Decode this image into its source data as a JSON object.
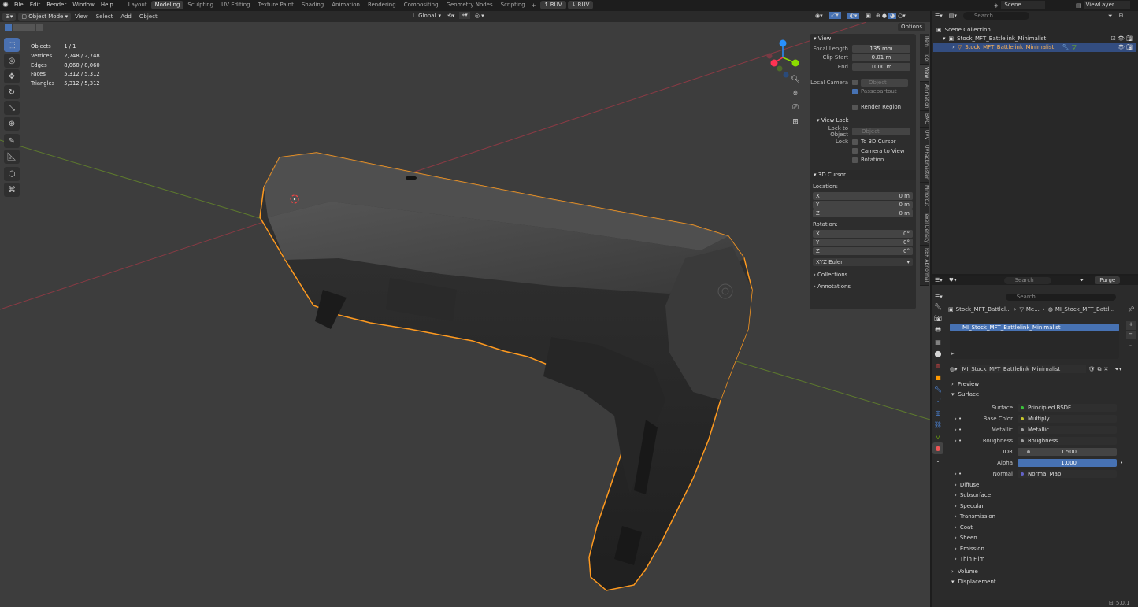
{
  "topbar": {
    "menus": [
      "File",
      "Edit",
      "Render",
      "Window",
      "Help"
    ],
    "workspaces": [
      "Layout",
      "Modeling",
      "Sculpting",
      "UV Editing",
      "Texture Paint",
      "Shading",
      "Animation",
      "Rendering",
      "Compositing",
      "Geometry Nodes",
      "Scripting"
    ],
    "active_workspace": "Modeling",
    "addon_buttons": [
      "RUV",
      "RUV"
    ],
    "scene": "Scene",
    "view_layer": "ViewLayer"
  },
  "viewport_header": {
    "mode": "Object Mode",
    "menus": [
      "View",
      "Select",
      "Add",
      "Object"
    ],
    "transform_orientation": "Global",
    "options_label": "Options"
  },
  "stats": [
    {
      "label": "Objects",
      "value": "1 / 1"
    },
    {
      "label": "Vertices",
      "value": "2,748 / 2,748"
    },
    {
      "label": "Edges",
      "value": "8,060 / 8,060"
    },
    {
      "label": "Faces",
      "value": "5,312 / 5,312"
    },
    {
      "label": "Triangles",
      "value": "5,312 / 5,312"
    }
  ],
  "npanel": {
    "view_title": "View",
    "focal_length_label": "Focal Length",
    "focal_length": "135 mm",
    "clip_start_label": "Clip Start",
    "clip_start": "0.01 m",
    "end_label": "End",
    "end": "1000 m",
    "local_camera_label": "Local Camera",
    "object_placeholder": "Object",
    "passepartout": "Passepartout",
    "render_region": "Render Region",
    "view_lock_title": "View Lock",
    "lock_to_object_label": "Lock to Object",
    "lock_label": "Lock",
    "to_3d_cursor": "To 3D Cursor",
    "camera_to_view": "Camera to View",
    "rotation_check": "Rotation",
    "cursor_title": "3D Cursor",
    "location_label": "Location:",
    "loc": [
      {
        "axis": "X",
        "value": "0 m"
      },
      {
        "axis": "Y",
        "value": "0 m"
      },
      {
        "axis": "Z",
        "value": "0 m"
      }
    ],
    "rotation_label": "Rotation:",
    "rot": [
      {
        "axis": "X",
        "value": "0°"
      },
      {
        "axis": "Y",
        "value": "0°"
      },
      {
        "axis": "Z",
        "value": "0°"
      }
    ],
    "rotation_mode": "XYZ Euler",
    "collections": "Collections",
    "annotations": "Annotations",
    "tabs": [
      "Item",
      "Tool",
      "View",
      "Animation",
      "BMC",
      "UVV",
      "UVPackmaster",
      "Mirrorcut",
      "Texel Density",
      "RBR Abnormal"
    ],
    "active_tab": "View"
  },
  "outliner": {
    "search_placeholder": "Search",
    "scene_collection": "Scene Collection",
    "collection": "Stock_MFT_Battlelink_Minimalist",
    "object": "Stock_MFT_Battlelink_Minimalist"
  },
  "properties": {
    "search_placeholder": "Search",
    "purge": "Purge",
    "breadcrumb": [
      "Stock_MFT_Battlel...",
      "Me...",
      "MI_Stock_MFT_Battl..."
    ],
    "material_slot": "MI_Stock_MFT_Battlelink_Minimalist",
    "material_name": "MI_Stock_MFT_Battlelink_Minimalist",
    "preview": "Preview",
    "surface_section": "Surface",
    "surface_label": "Surface",
    "surface_value": "Principled BSDF",
    "inputs": [
      {
        "label": "Base Color",
        "value": "Multiply",
        "color": "#c7c729"
      },
      {
        "label": "Metallic",
        "value": "Metallic",
        "color": "#a0a0a0"
      },
      {
        "label": "Roughness",
        "value": "Roughness",
        "color": "#a0a0a0"
      }
    ],
    "ior_label": "IOR",
    "ior": "1.500",
    "alpha_label": "Alpha",
    "alpha": "1.000",
    "normal_label": "Normal",
    "normal_value": "Normal Map",
    "subsections": [
      "Diffuse",
      "Subsurface",
      "Specular",
      "Transmission",
      "Coat",
      "Sheen",
      "Emission",
      "Thin Film"
    ],
    "volume": "Volume",
    "displacement": "Displacement"
  },
  "status": {
    "version": "5.0.1"
  },
  "colors": {
    "accent": "#4772b3",
    "selection": "#ff9a1f",
    "x_axis": "#ff3352",
    "y_axis": "#8bdc00",
    "z_axis": "#2890ff"
  }
}
